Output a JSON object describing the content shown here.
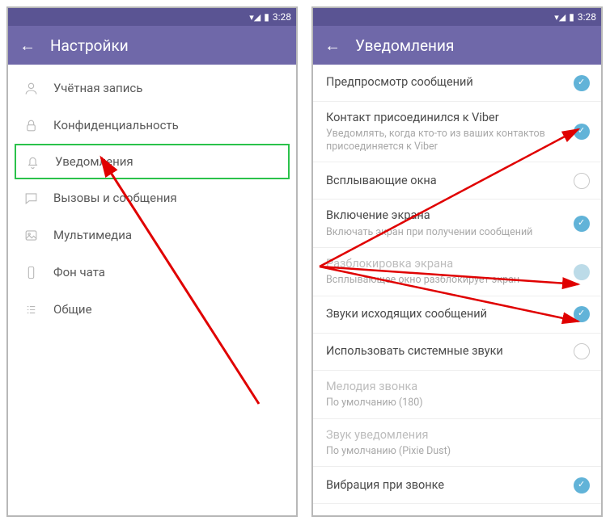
{
  "statusbar": {
    "time": "3:28"
  },
  "left": {
    "title": "Настройки",
    "items": [
      {
        "key": "account",
        "label": "Учётная запись"
      },
      {
        "key": "privacy",
        "label": "Конфиденциальность"
      },
      {
        "key": "notif",
        "label": "Уведомления"
      },
      {
        "key": "calls",
        "label": "Вызовы и сообщения"
      },
      {
        "key": "media",
        "label": "Мультимедиа"
      },
      {
        "key": "bg",
        "label": "Фон чата"
      },
      {
        "key": "general",
        "label": "Общие"
      }
    ]
  },
  "right": {
    "title": "Уведомления",
    "opts": [
      {
        "title": "Предпросмотр сообщений",
        "sub": "",
        "state": "on"
      },
      {
        "title": "Контакт присоединился к Viber",
        "sub": "Уведомлять, когда кто-то из ваших контактов присоединяется к Viber",
        "state": "on"
      },
      {
        "title": "Всплывающие окна",
        "sub": "",
        "state": "off"
      },
      {
        "title": "Включение экрана",
        "sub": "Включать экран при получении сообщений",
        "state": "on"
      },
      {
        "title": "Разблокировка экрана",
        "sub": "Всплывающее окно разблокирует экран",
        "state": "dim",
        "disabled": true
      },
      {
        "title": "Звуки исходящих сообщений",
        "sub": "",
        "state": "on"
      },
      {
        "title": "Использовать системные звуки",
        "sub": "",
        "state": "off"
      },
      {
        "title": "Мелодия звонка",
        "sub": "По умолчанию (180)",
        "state": "",
        "disabled": true
      },
      {
        "title": "Звук уведомления",
        "sub": "По умолчанию (Pixie Dust)",
        "state": "",
        "disabled": true
      },
      {
        "title": "Вибрация при звонке",
        "sub": "",
        "state": "on"
      }
    ]
  }
}
